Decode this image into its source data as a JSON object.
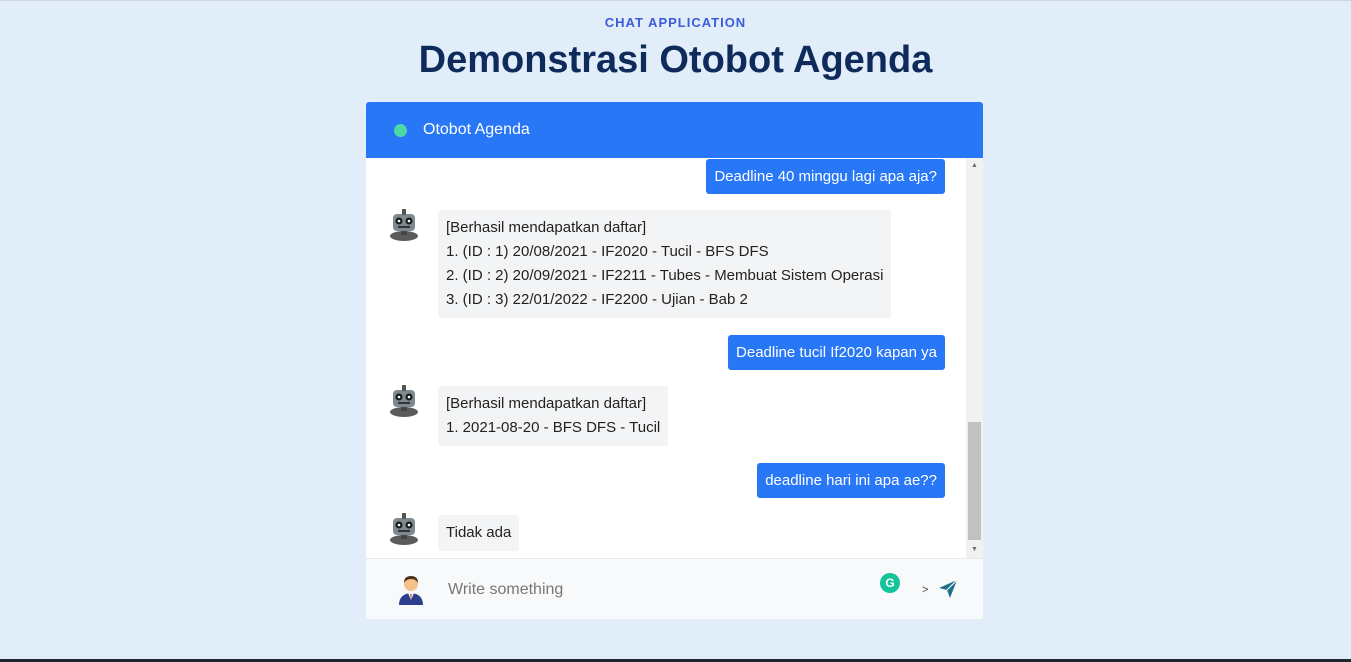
{
  "header": {
    "eyebrow": "CHAT APPLICATION",
    "title": "Demonstrasi Otobot Agenda"
  },
  "chat": {
    "name": "Otobot Agenda",
    "status_color": "#4cd9a6",
    "accent_color": "#2777f7",
    "messages": [
      {
        "from": "user",
        "text": "Deadline 40 minggu lagi apa aja?"
      },
      {
        "from": "bot",
        "lines": [
          "[Berhasil mendapatkan daftar]",
          "1. (ID : 1) 20/08/2021 - IF2020 - Tucil - BFS DFS",
          "2. (ID : 2) 20/09/2021 - IF2211 - Tubes - Membuat Sistem Operasi",
          "3. (ID : 3) 22/01/2022 - IF2200 - Ujian - Bab 2"
        ]
      },
      {
        "from": "user",
        "text": "Deadline tucil If2020 kapan ya"
      },
      {
        "from": "bot",
        "lines": [
          "[Berhasil mendapatkan daftar]",
          "1. 2021-08-20 - BFS DFS - Tucil"
        ]
      },
      {
        "from": "user",
        "text": "deadline hari ini apa ae??"
      },
      {
        "from": "bot",
        "lines": [
          "Tidak ada"
        ]
      }
    ]
  },
  "input": {
    "placeholder": "Write something",
    "value": "",
    "caret_text": ">",
    "grammarly_icon": "grammarly-icon",
    "send_icon": "send-icon"
  }
}
